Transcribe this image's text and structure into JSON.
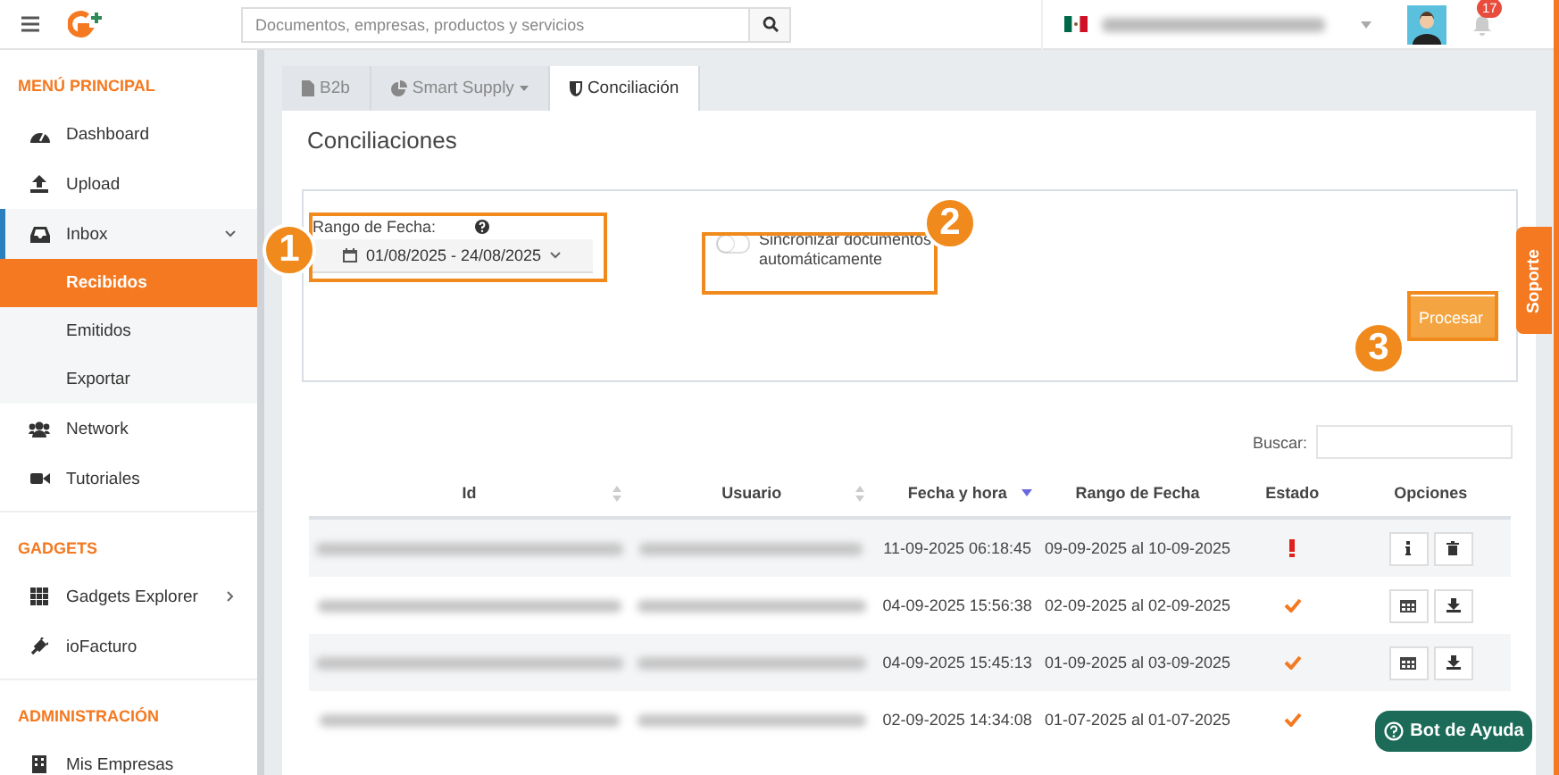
{
  "topbar": {
    "search": {
      "placeholder": "Documentos, empresas, productos y servicios"
    },
    "notifications": "17"
  },
  "sidebar": {
    "sections": [
      {
        "title": "MENÚ PRINCIPAL",
        "items": [
          {
            "label": "Dashboard",
            "selected": false
          },
          {
            "label": "Upload",
            "selected": false
          },
          {
            "label": "Inbox",
            "selected": false,
            "expanded": true,
            "children": [
              {
                "label": "Recibidos",
                "selected": true
              },
              {
                "label": "Emitidos",
                "selected": false
              },
              {
                "label": "Exportar",
                "selected": false
              }
            ]
          },
          {
            "label": "Network",
            "selected": false
          },
          {
            "label": "Tutoriales",
            "selected": false
          }
        ]
      },
      {
        "title": "GADGETS",
        "items": [
          {
            "label": "Gadgets Explorer",
            "selected": false,
            "expanded": false
          },
          {
            "label": "ioFacturo",
            "selected": false
          }
        ]
      },
      {
        "title": "ADMINISTRACIÓN",
        "items": [
          {
            "label": "Mis Empresas",
            "selected": false
          }
        ]
      }
    ]
  },
  "tabs": [
    {
      "label": "B2b",
      "selected": false,
      "dropdown": false
    },
    {
      "label": "Smart Supply",
      "selected": false,
      "dropdown": true
    },
    {
      "label": "Conciliación",
      "selected": true,
      "dropdown": false
    }
  ],
  "panel": {
    "title": "Conciliaciones",
    "date_range": {
      "label": "Rango de Fecha:",
      "value": "01/08/2025 - 24/08/2025"
    },
    "sync": {
      "label": "Sincronizar documentos automáticamente",
      "on": false
    },
    "process_button": "Procesar",
    "annotations": [
      "1",
      "2",
      "3"
    ],
    "search_label": "Buscar:",
    "table": {
      "columns": [
        {
          "label": "Id",
          "sortable": true,
          "sorted": false
        },
        {
          "label": "Usuario",
          "sortable": true,
          "sorted": false
        },
        {
          "label": "Fecha y hora",
          "sortable": true,
          "sorted": true
        },
        {
          "label": "Rango de Fecha",
          "sortable": false,
          "sorted": false
        },
        {
          "label": "Estado",
          "sortable": false,
          "sorted": false
        },
        {
          "label": "Opciones",
          "sortable": false,
          "sorted": false
        }
      ],
      "rows": [
        {
          "datetime": "11-09-2025 06:18:45",
          "range": "09-09-2025 al 10-09-2025",
          "kind": "error",
          "actions": [
            {
              "kind": "info"
            },
            {
              "kind": "delete"
            }
          ]
        },
        {
          "datetime": "04-09-2025 15:56:38",
          "range": "02-09-2025 al 02-09-2025",
          "kind": "ok",
          "actions": [
            {
              "kind": "table"
            },
            {
              "kind": "download"
            }
          ]
        },
        {
          "datetime": "04-09-2025 15:45:13",
          "range": "01-09-2025 al 03-09-2025",
          "kind": "ok",
          "actions": [
            {
              "kind": "table"
            },
            {
              "kind": "download"
            }
          ]
        },
        {
          "datetime": "02-09-2025 14:34:08",
          "range": "01-07-2025 al 01-07-2025",
          "kind": "ok",
          "actions": []
        }
      ]
    }
  },
  "support_tab": "Soporte",
  "help_bot": "Bot de Ayuda"
}
